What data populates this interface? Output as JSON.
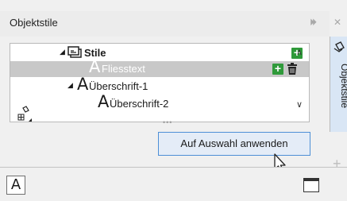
{
  "panel": {
    "title": "Objektstile",
    "forward_glyph": "⏵⏵",
    "close_glyph": "✕"
  },
  "tree": {
    "root": {
      "expander": "◢",
      "label": "Stile",
      "icon": "folder-stack-icon"
    },
    "items": [
      {
        "label": "Fliesstext",
        "selected": true,
        "glyph": "A"
      },
      {
        "label": "Überschrift-1",
        "selected": false,
        "expander": "◢",
        "glyph": "A"
      },
      {
        "label": "Überschrift-2",
        "selected": false,
        "glyph": "A"
      }
    ],
    "add_glyph": "+",
    "delete_glyph": "🗑",
    "scroll_up": "∧",
    "scroll_down": "∨",
    "more": "•••"
  },
  "apply_button": {
    "label": "Auf Auswahl anwenden"
  },
  "side_tab": {
    "label": "Objektstile",
    "add_glyph": "+"
  },
  "bottom": {
    "text_style_glyph": "A"
  }
}
